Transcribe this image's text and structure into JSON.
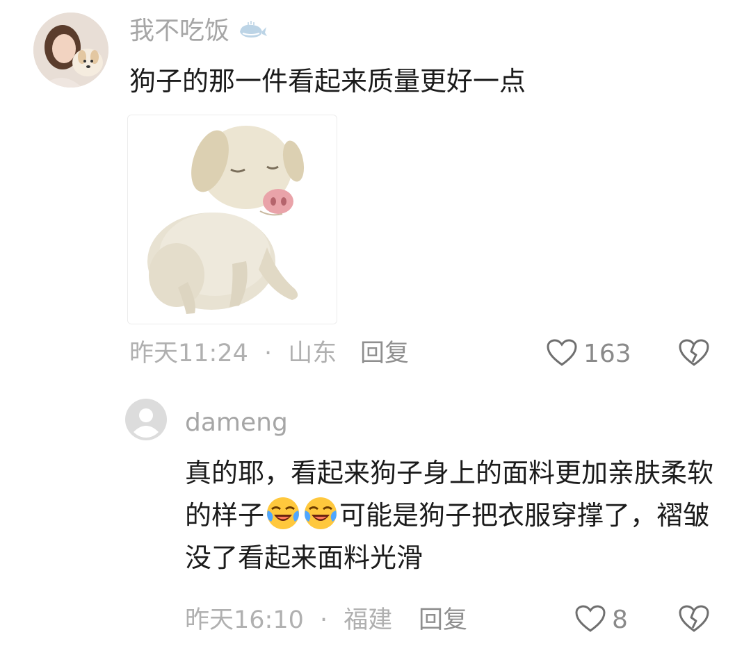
{
  "comment": {
    "username": "我不吃饭",
    "text": "狗子的那一件看起来质量更好一点",
    "time": "昨天11:24",
    "separator": "·",
    "location": "山东",
    "reply_label": "回复",
    "likes": "163"
  },
  "reply": {
    "username": "dameng",
    "text_part1": "真的耶，看起来狗子身上的面料更加亲肤柔软的样子",
    "text_part2": "可能是狗子把衣服穿撑了，褶皱没了看起来面料光滑",
    "time": "昨天16:10",
    "separator": "·",
    "location": "福建",
    "reply_label": "回复",
    "likes": "8"
  },
  "icons": {
    "username_badge": "whale-icon",
    "like": "heart-outline-icon",
    "dislike": "broken-heart-icon",
    "emoji": "laughing-crying-emoji-icon"
  },
  "colors": {
    "username": "#a6a6a6",
    "text": "#1b1b1b",
    "meta": "#b0b0b0",
    "icon": "#7a7a7a"
  }
}
